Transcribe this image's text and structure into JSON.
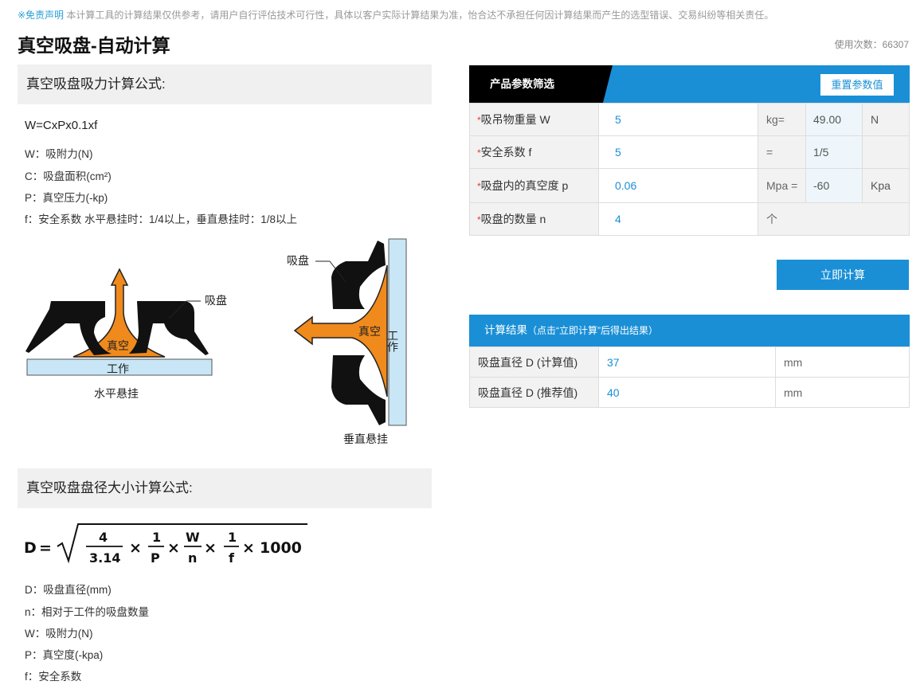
{
  "disclaimer": {
    "link": "※免责声明",
    "text": "本计算工具的计算结果仅供参考，请用户自行评估技术可行性，具体以客户实际计算结果为准，怡合达不承担任何因计算结果而产生的选型错误、交易纠纷等相关责任。"
  },
  "page": {
    "title": "真空吸盘-自动计算",
    "usage_label": "使用次数：",
    "usage_count": "66307"
  },
  "section1": {
    "title": "真空吸盘吸力计算公式:",
    "formula": "W=CxPx0.1xf",
    "defs": [
      "W：吸附力(N)",
      "C：吸盘面积(cm²)",
      "P：真空压力(-kp)",
      "f：安全系数  水平悬挂时：1/4以上，垂直悬挂时：1/8以上"
    ]
  },
  "illustration": {
    "horizontal": {
      "cup_label": "吸盘",
      "vacuum_label": "真空",
      "work_label": "工作",
      "caption": "水平悬挂"
    },
    "vertical": {
      "cup_label": "吸盘",
      "vacuum_label": "真空",
      "work_label": "工作",
      "caption": "垂直悬挂"
    }
  },
  "section2": {
    "title": "真空吸盘盘径大小计算公式:",
    "formula": {
      "lhs": "D",
      "eq": "=",
      "n1": "4",
      "d1": "3.14",
      "n2": "1",
      "d2": "P",
      "n3": "W",
      "d3": "n",
      "n4": "1",
      "d4": "f",
      "times": "×",
      "tail": "1000"
    },
    "defs": [
      "D：吸盘直径(mm)",
      "n：相对于工件的吸盘数量",
      "W：吸附力(N)",
      "P：真空度(-kpa)",
      "f：安全系数"
    ]
  },
  "params": {
    "tab_label": "产品参数筛选",
    "reset_label": "重置参数值",
    "required_mark": "*",
    "rows": [
      {
        "label": "吸吊物重量 W",
        "value": "5",
        "unit": "kg=",
        "converted": "49.00",
        "unit2": "N"
      },
      {
        "label": "安全系数 f",
        "value": "5",
        "unit": "=",
        "converted": "1/5",
        "unit2": ""
      },
      {
        "label": "吸盘内的真空度 p",
        "value": "0.06",
        "unit": "Mpa =",
        "converted": "-60",
        "unit2": "Kpa"
      },
      {
        "label": "吸盘的数量 n",
        "value": "4",
        "unit": "个"
      }
    ]
  },
  "calc_button": "立即计算",
  "results": {
    "title": "计算结果",
    "hint": "（点击“立即计算”后得出结果）",
    "rows": [
      {
        "label": "吸盘直径 D (计算值)",
        "value": "37",
        "unit": "mm"
      },
      {
        "label": "吸盘直径 D (推荐值)",
        "value": "40",
        "unit": "mm"
      }
    ]
  },
  "colors": {
    "accent": "#1a8fd6",
    "vacuum_orange": "#f08a1c",
    "workpiece": "#c8e6f5",
    "required": "#e04040"
  }
}
